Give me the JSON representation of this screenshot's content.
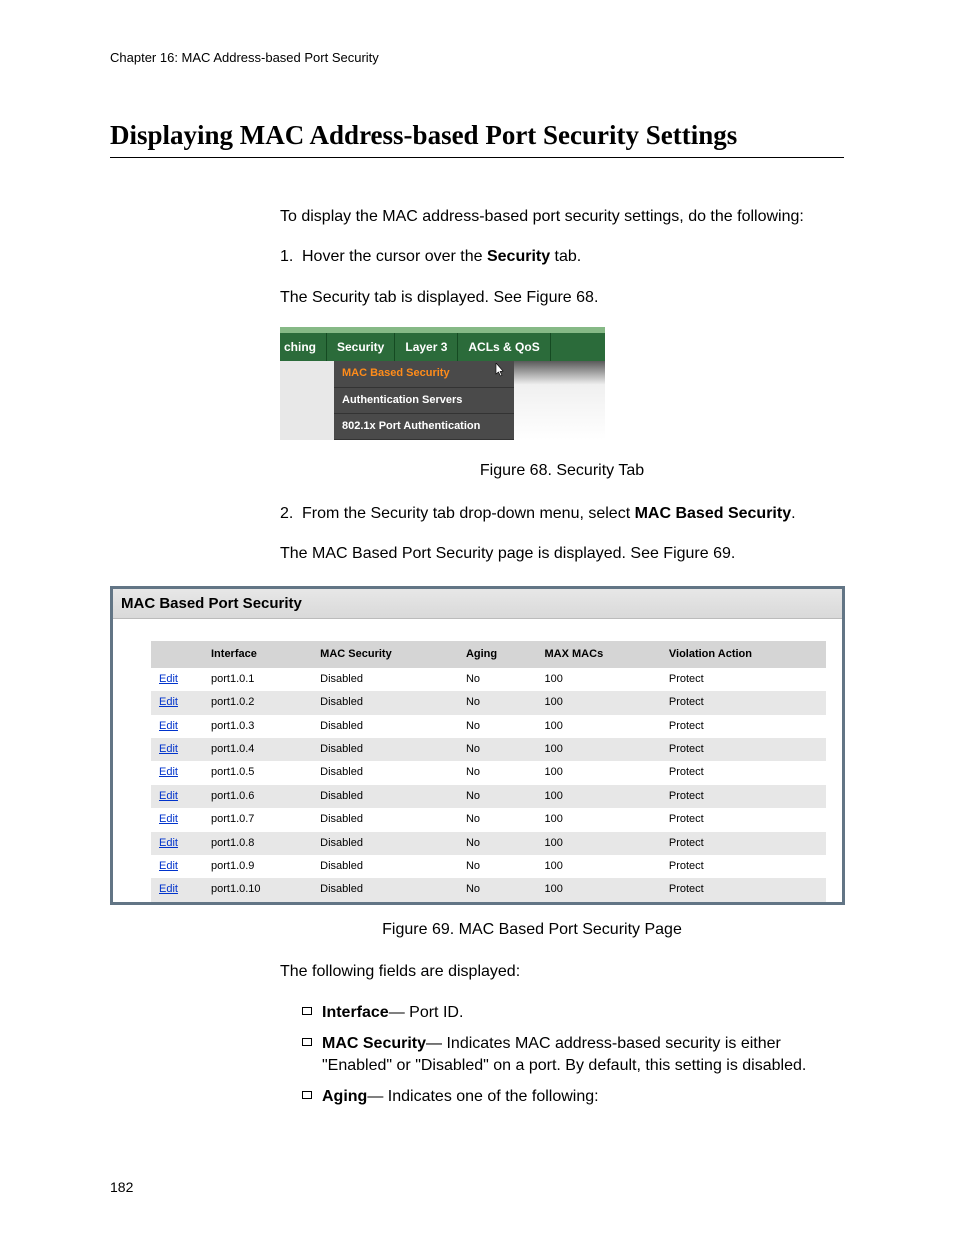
{
  "header": {
    "chapter_line": "Chapter 16: MAC Address-based Port Security"
  },
  "title": "Displaying MAC Address-based Port Security Settings",
  "intro": "To display the MAC address-based port security settings, do the following:",
  "step1_num": "1.",
  "step1_pre": "Hover the cursor over the ",
  "step1_bold": "Security",
  "step1_post": " tab.",
  "step1_result": "The Security tab is displayed. See Figure 68.",
  "fig68": {
    "tabs": [
      "ching",
      "Security",
      "Layer 3",
      "ACLs & QoS"
    ],
    "menu": [
      "MAC Based Security",
      "Authentication Servers",
      "802.1x Port Authentication"
    ],
    "caption": "Figure 68. Security Tab"
  },
  "step2_num": "2.",
  "step2_pre": "From the Security tab drop-down menu, select ",
  "step2_bold": "MAC Based Security",
  "step2_post": ".",
  "step2_result": "The MAC Based Port Security page is displayed. See Figure 69.",
  "fig69": {
    "panel_title": "MAC Based Port Security",
    "edit_label": "Edit",
    "headers": [
      "Interface",
      "MAC Security",
      "Aging",
      "MAX MACs",
      "Violation Action"
    ],
    "rows": [
      {
        "iface": "port1.0.1",
        "sec": "Disabled",
        "aging": "No",
        "max": "100",
        "violation": "Protect"
      },
      {
        "iface": "port1.0.2",
        "sec": "Disabled",
        "aging": "No",
        "max": "100",
        "violation": "Protect"
      },
      {
        "iface": "port1.0.3",
        "sec": "Disabled",
        "aging": "No",
        "max": "100",
        "violation": "Protect"
      },
      {
        "iface": "port1.0.4",
        "sec": "Disabled",
        "aging": "No",
        "max": "100",
        "violation": "Protect"
      },
      {
        "iface": "port1.0.5",
        "sec": "Disabled",
        "aging": "No",
        "max": "100",
        "violation": "Protect"
      },
      {
        "iface": "port1.0.6",
        "sec": "Disabled",
        "aging": "No",
        "max": "100",
        "violation": "Protect"
      },
      {
        "iface": "port1.0.7",
        "sec": "Disabled",
        "aging": "No",
        "max": "100",
        "violation": "Protect"
      },
      {
        "iface": "port1.0.8",
        "sec": "Disabled",
        "aging": "No",
        "max": "100",
        "violation": "Protect"
      },
      {
        "iface": "port1.0.9",
        "sec": "Disabled",
        "aging": "No",
        "max": "100",
        "violation": "Protect"
      },
      {
        "iface": "port1.0.10",
        "sec": "Disabled",
        "aging": "No",
        "max": "100",
        "violation": "Protect"
      }
    ],
    "caption": "Figure 69. MAC Based Port Security Page"
  },
  "fields_intro": "The following fields are displayed:",
  "fields": [
    {
      "name": "Interface",
      "desc": "— Port ID."
    },
    {
      "name": "MAC Security",
      "desc": "— Indicates MAC address-based security is either \"Enabled\" or \"Disabled\" on a port. By default, this setting is disabled."
    },
    {
      "name": "Aging",
      "desc": "— Indicates one of the following:"
    }
  ],
  "page_number": "182"
}
